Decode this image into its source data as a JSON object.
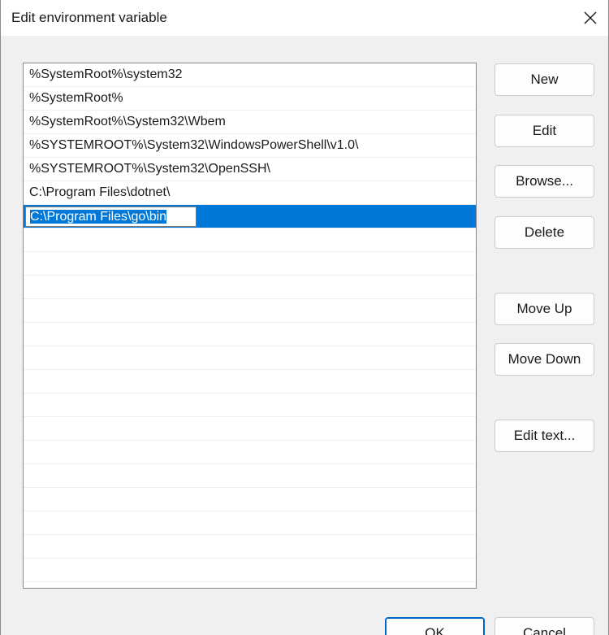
{
  "window": {
    "title": "Edit environment variable",
    "close_icon": "close-icon"
  },
  "list": {
    "items": [
      "%SystemRoot%\\system32",
      "%SystemRoot%",
      "%SystemRoot%\\System32\\Wbem",
      "%SYSTEMROOT%\\System32\\WindowsPowerShell\\v1.0\\",
      "%SYSTEMROOT%\\System32\\OpenSSH\\",
      "C:\\Program Files\\dotnet\\"
    ],
    "editing_value": "C:\\Program Files\\go\\bin",
    "selected_color": "#0078d7"
  },
  "buttons": {
    "new": "New",
    "edit": "Edit",
    "browse": "Browse...",
    "delete": "Delete",
    "move_up": "Move Up",
    "move_down": "Move Down",
    "edit_text": "Edit text..."
  },
  "footer": {
    "ok": "OK",
    "cancel": "Cancel"
  },
  "colors": {
    "accent": "#0067c0",
    "selection": "#0078d7"
  }
}
